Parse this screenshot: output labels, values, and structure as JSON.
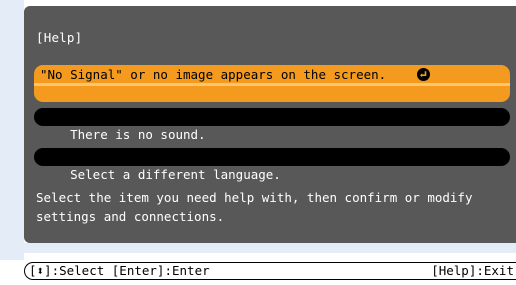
{
  "menu": {
    "title": "[Help]",
    "items": [
      {
        "label": "\"No Signal\" or no image appears on the screen."
      },
      {
        "label": "There is no sound."
      },
      {
        "label": "Select a different language."
      }
    ],
    "description": "Select the item you need help with, then confirm or modify\nsettings and connections."
  },
  "footer": {
    "left": "[⬍]:Select [Enter]:Enter",
    "right": "[Help]:Exit"
  },
  "colors": {
    "panel": "#585858",
    "highlight": "#f39a1f",
    "item_bg": "#000000",
    "side_bar": "#e3ecf7"
  },
  "icons": {
    "enter": "enter-return-icon"
  }
}
